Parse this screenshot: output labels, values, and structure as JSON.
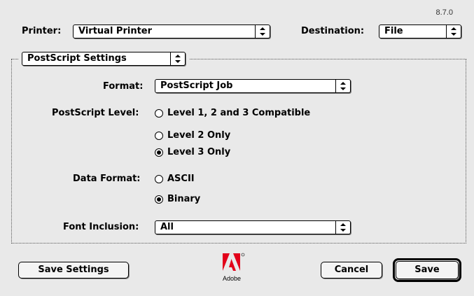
{
  "version": "8.7.0",
  "printer": {
    "label": "Printer:",
    "value": "Virtual Printer"
  },
  "destination": {
    "label": "Destination:",
    "value": "File"
  },
  "settings_menu": {
    "value": "PostScript Settings"
  },
  "format": {
    "label": "Format:",
    "value": "PostScript Job"
  },
  "postscript_level": {
    "label": "PostScript Level:",
    "options": [
      "Level 1, 2 and 3 Compatible",
      "Level 2 Only",
      "Level 3 Only"
    ],
    "selected": "Level 3 Only"
  },
  "data_format": {
    "label": "Data Format:",
    "options": [
      "ASCII",
      "Binary"
    ],
    "selected": "Binary"
  },
  "font_inclusion": {
    "label": "Font Inclusion:",
    "value": "All"
  },
  "buttons": {
    "save_settings": "Save Settings",
    "cancel": "Cancel",
    "save": "Save"
  },
  "logo": {
    "text": "Adobe",
    "icon": "adobe-logo-icon"
  }
}
